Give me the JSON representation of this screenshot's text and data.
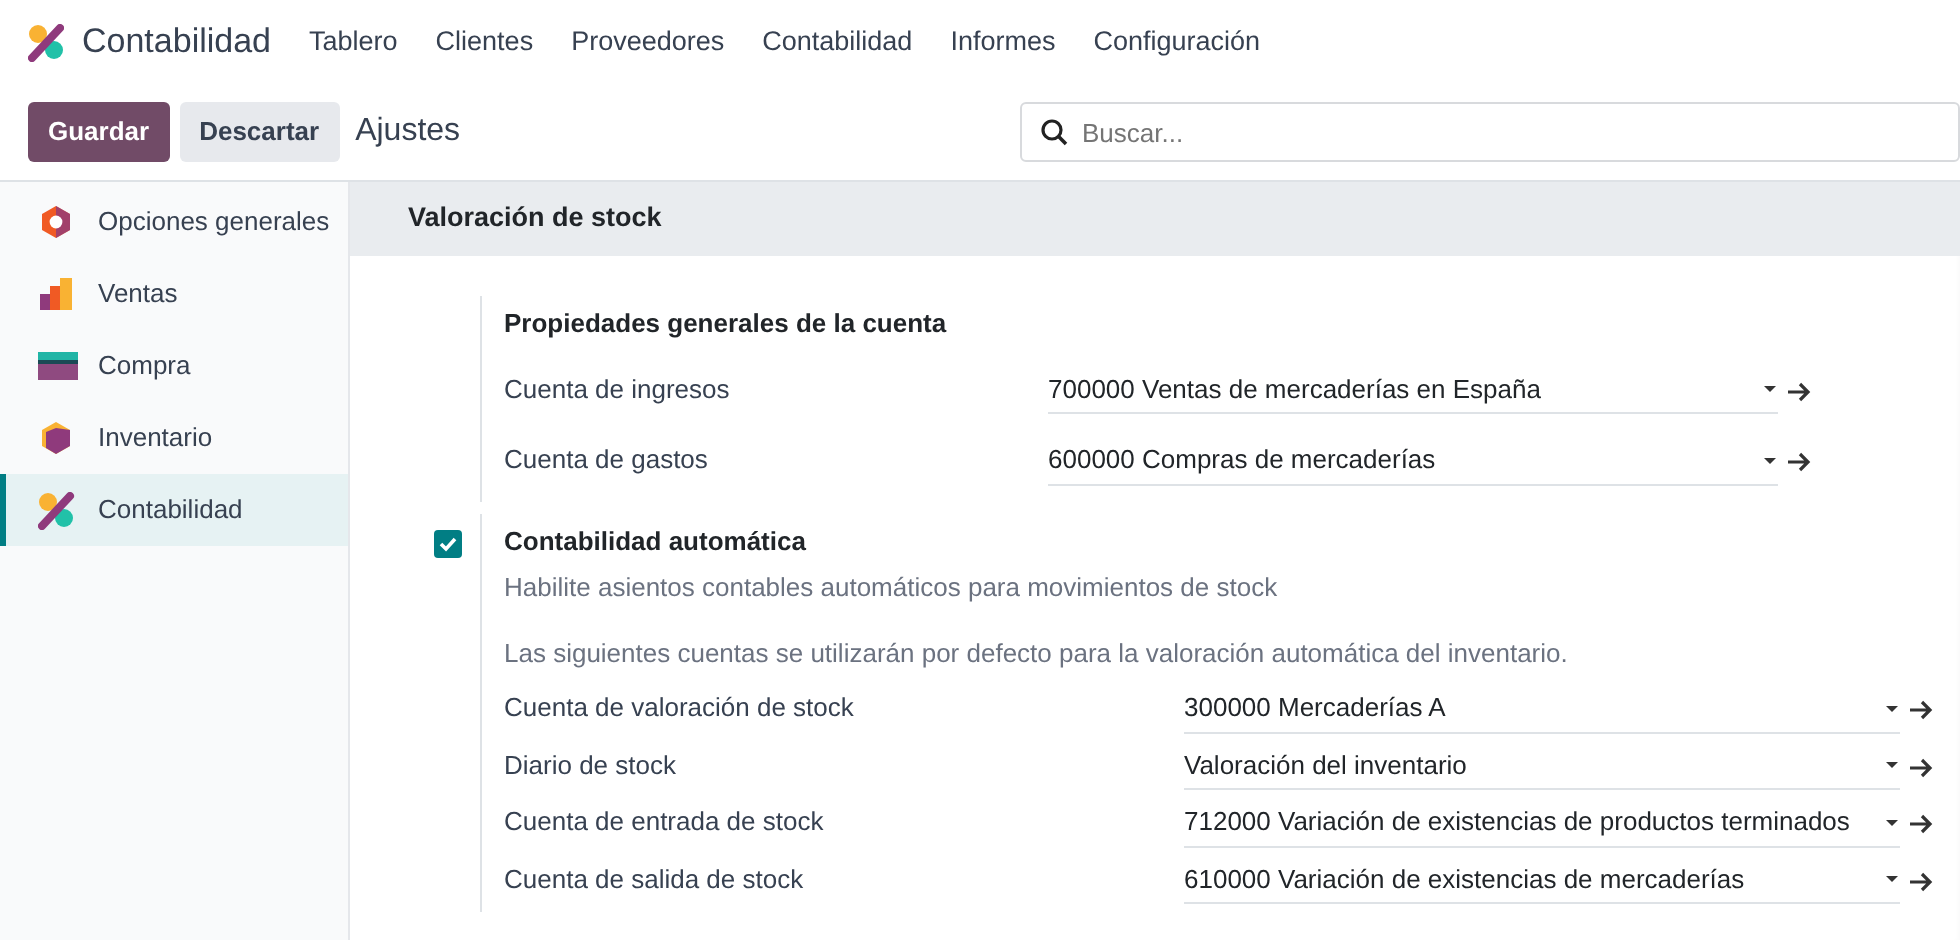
{
  "app": {
    "name": "Contabilidad"
  },
  "menu": [
    "Tablero",
    "Clientes",
    "Proveedores",
    "Contabilidad",
    "Informes",
    "Configuración"
  ],
  "control_bar": {
    "save": "Guardar",
    "discard": "Descartar",
    "breadcrumb": "Ajustes",
    "search": {
      "placeholder": "Buscar..."
    }
  },
  "sidebar": {
    "items": [
      {
        "label": "Opciones generales",
        "selected": false
      },
      {
        "label": "Ventas",
        "selected": false
      },
      {
        "label": "Compra",
        "selected": false
      },
      {
        "label": "Inventario",
        "selected": false
      },
      {
        "label": "Contabilidad",
        "selected": true
      }
    ]
  },
  "section": {
    "title": "Valoración de stock",
    "blocks": [
      {
        "kind": "group",
        "title": "Propiedades generales de la cuenta",
        "fields": [
          {
            "label": "Cuenta de ingresos",
            "value": "700000 Ventas de mercaderías en España"
          },
          {
            "label": "Cuenta de gastos",
            "value": "600000 Compras de mercaderías"
          }
        ]
      },
      {
        "kind": "setting",
        "checked": true,
        "title": "Contabilidad automática",
        "description": "Habilite asientos contables automáticos para movimientos de stock",
        "note": "Las siguientes cuentas se utilizarán por defecto para la valoración automática del inventario.",
        "fields": [
          {
            "label": "Cuenta de valoración de stock",
            "value": "300000 Mercaderías A"
          },
          {
            "label": "Diario de stock",
            "value": "Valoración del inventario"
          },
          {
            "label": "Cuenta de entrada de stock",
            "value": "712000 Variación de existencias de productos terminados"
          },
          {
            "label": "Cuenta de salida de stock",
            "value": "610000 Variación de existencias de mercaderías"
          }
        ]
      }
    ]
  }
}
